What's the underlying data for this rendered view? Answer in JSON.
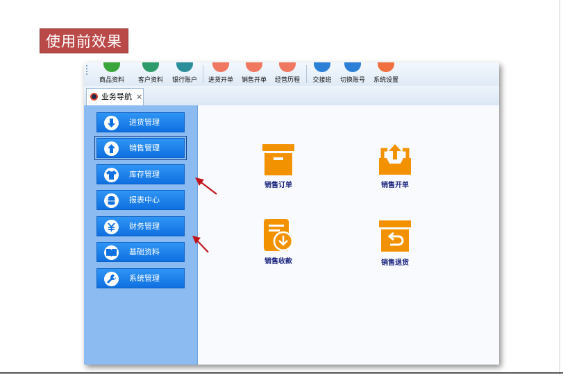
{
  "caption": "使用前效果",
  "toolbar": {
    "buttons": [
      {
        "label": "商品资料",
        "color": "#3aa53a"
      },
      {
        "label": "客户资料",
        "color": "#2d9b6a"
      },
      {
        "label": "银行账户",
        "color": "#2a8f9a"
      },
      {
        "label": "进货开单",
        "color": "#f07860"
      },
      {
        "label": "销售开单",
        "color": "#f07860"
      },
      {
        "label": "经营历程",
        "color": "#f07860"
      },
      {
        "label": "交接班",
        "color": "#2b7fd6"
      },
      {
        "label": "切换账号",
        "color": "#2b7fd6"
      },
      {
        "label": "系统设置",
        "color": "#f07040"
      }
    ]
  },
  "tab": {
    "title": "业务导航",
    "close": "×"
  },
  "sidebar": {
    "items": [
      {
        "label": "进货管理",
        "icon": "arrow-down-icon"
      },
      {
        "label": "销售管理",
        "icon": "arrow-up-icon"
      },
      {
        "label": "库存管理",
        "icon": "shirt-icon"
      },
      {
        "label": "报表中心",
        "icon": "database-icon"
      },
      {
        "label": "财务管理",
        "icon": "yuan-icon"
      },
      {
        "label": "基础资料",
        "icon": "book-icon"
      },
      {
        "label": "系统管理",
        "icon": "wrench-icon"
      }
    ]
  },
  "main": {
    "tiles": [
      {
        "label": "销售订单",
        "icon": "box-icon"
      },
      {
        "label": "销售开单",
        "icon": "outbox-icon"
      },
      {
        "label": "销售收款",
        "icon": "receipt-download-icon"
      },
      {
        "label": "销售退货",
        "icon": "return-box-icon"
      }
    ]
  },
  "colors": {
    "accent": "#0f70e0",
    "tile": "#f39200",
    "sidebar": "#8bbbf0",
    "caption": "#b94a48",
    "arrow": "#c0151b"
  }
}
